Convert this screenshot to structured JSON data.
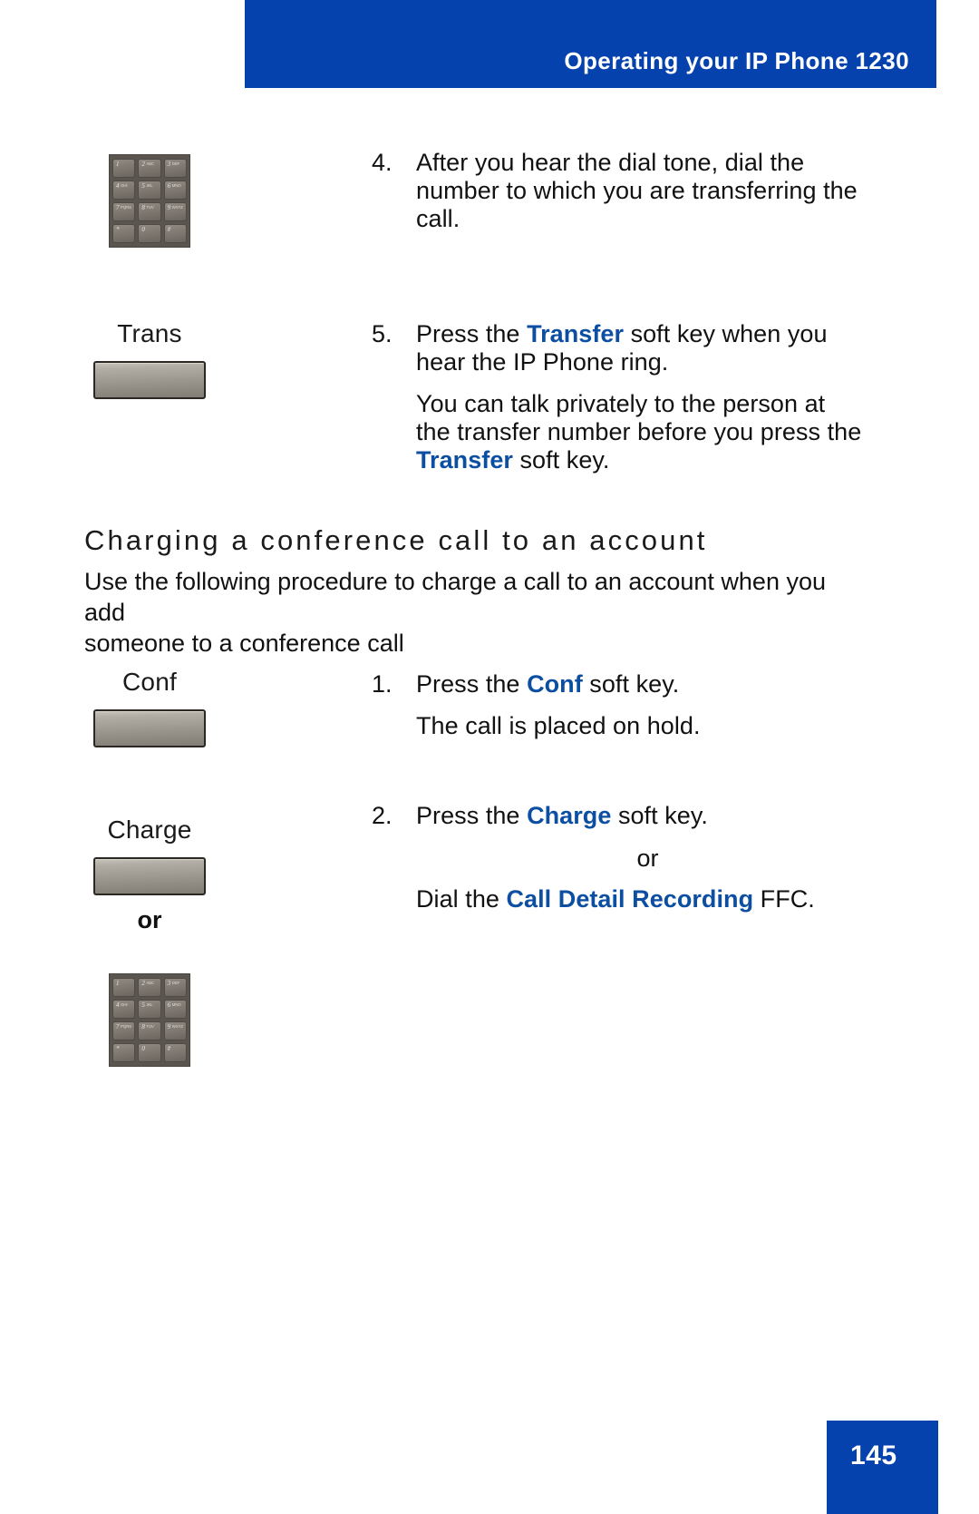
{
  "header": {
    "title": "Operating your IP Phone 1230",
    "banner_color": "#0542ad",
    "title_color": "#ffffff"
  },
  "theme": {
    "accent_blue": "#0542ad",
    "keyword_blue": "#0b4ea2",
    "body_text": "#111111"
  },
  "steps_transfer": [
    {
      "number": "4.",
      "art": "dialpad",
      "lines": [
        "After you hear the dial tone, dial the number to which you are transferring the call."
      ]
    },
    {
      "number": "5.",
      "art": "softkey",
      "softkey_label": "Trans",
      "lines": [
        "Press the Transfer soft key when you hear the IP Phone ring.",
        "You can talk privately to the person at the transfer number before you press the Transfer soft key."
      ]
    }
  ],
  "section": {
    "heading": "Charging a conference call to an account",
    "intro": "Use the following procedure to charge a call to an account when you add someone to a conference call"
  },
  "steps_charge": [
    {
      "number": "1.",
      "softkey_label": "Conf",
      "line_main": "Press the Conf soft key.",
      "line_sub": "The call is placed on hold."
    },
    {
      "number": "2.",
      "softkey_label": "Charge",
      "line_main": "Press the Charge soft key.",
      "or_label": "or",
      "line_alt": "Dial the Call Detail Recording FFC."
    }
  ],
  "text_fragments": {
    "step5_pre": "Press the ",
    "step5_kw": "Transfer",
    "step5_post": " soft key when you",
    "step5_line2": "hear the IP Phone ring.",
    "step5b_line1": "You can talk privately to the person at",
    "step5b_line2": "the transfer number before you press the",
    "step5b_kw": "Transfer",
    "step5b_post": " soft key.",
    "step4_line1": "After you hear the dial tone, dial the",
    "step4_line2": "number to which you are transferring the",
    "step4_line3": "call.",
    "intro_line1": "Use the following procedure to charge a call to an account when you add",
    "intro_line2": "someone to a conference call",
    "step1_pre": "Press the ",
    "step1_kw": "Conf",
    "step1_post": " soft key.",
    "step1_sub": "The call is placed on hold.",
    "step2_pre": "Press the ",
    "step2_kw": "Charge",
    "step2_post": " soft key.",
    "step2_or": "or",
    "step2_alt_pre": "Dial the ",
    "step2_alt_kw": "Call Detail Recording",
    "step2_alt_post": " FFC."
  },
  "left_column": {
    "trans_label": "Trans",
    "conf_label": "Conf",
    "charge_label": "Charge",
    "or_label": "or"
  },
  "dialpad": {
    "keys": [
      {
        "digit": "1",
        "letters": ""
      },
      {
        "digit": "2",
        "letters": "ABC"
      },
      {
        "digit": "3",
        "letters": "DEF"
      },
      {
        "digit": "4",
        "letters": "GHI"
      },
      {
        "digit": "5",
        "letters": "JKL"
      },
      {
        "digit": "6",
        "letters": "MNO"
      },
      {
        "digit": "7",
        "letters": "PQRS"
      },
      {
        "digit": "8",
        "letters": "TUV"
      },
      {
        "digit": "9",
        "letters": "WXYZ"
      },
      {
        "digit": "*",
        "letters": ""
      },
      {
        "digit": "0",
        "letters": ""
      },
      {
        "digit": "#",
        "letters": ""
      }
    ]
  },
  "footer": {
    "page_number": "145"
  }
}
